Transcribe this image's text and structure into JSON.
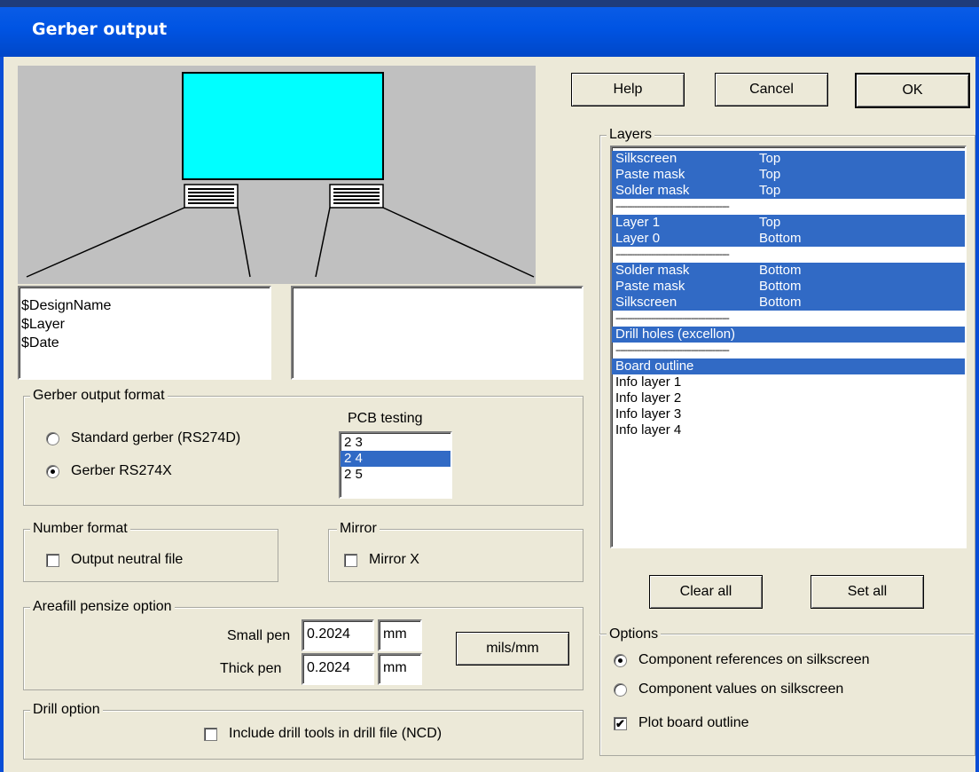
{
  "window": {
    "title": "Gerber output"
  },
  "buttons": {
    "help": "Help",
    "cancel": "Cancel",
    "ok": "OK",
    "clear_all": "Clear all",
    "set_all": "Set all",
    "units": "mils/mm"
  },
  "preview": {
    "text_lines": [
      "$DesignName",
      "$Layer",
      "$Date"
    ],
    "board_color": "#00ffff"
  },
  "gerber_format": {
    "label": "Gerber output format",
    "standard": "Standard gerber (RS274D)",
    "x": "Gerber RS274X",
    "selected": "Gerber RS274X",
    "pcb_testing_label": "PCB testing",
    "pcb_testing_items": [
      "2 3",
      "2 4",
      "2 5"
    ],
    "pcb_testing_selected": "2 4"
  },
  "number_format": {
    "label": "Number format",
    "neutral": "Output neutral file",
    "neutral_checked": false
  },
  "mirror": {
    "label": "Mirror",
    "x": "Mirror X",
    "x_checked": false
  },
  "areafill": {
    "label": "Areafill pensize option",
    "small_label": "Small pen",
    "small_value": "0.2024",
    "small_unit": "mm",
    "thick_label": "Thick pen",
    "thick_value": "0.2024",
    "thick_unit": "mm"
  },
  "drill": {
    "label": "Drill option",
    "include": "Include drill tools in drill file (NCD)",
    "include_checked": false
  },
  "layers": {
    "label": "Layers",
    "separator": "------------------------------------------------",
    "rows": [
      {
        "name": "Silkscreen",
        "side": "Top",
        "selected": true
      },
      {
        "name": "Paste mask",
        "side": "Top",
        "selected": true
      },
      {
        "name": "Solder mask",
        "side": "Top",
        "selected": true
      },
      {
        "sep": true
      },
      {
        "name": "Layer 1",
        "side": "Top",
        "selected": true
      },
      {
        "name": "Layer 0",
        "side": "Bottom",
        "selected": true
      },
      {
        "sep": true
      },
      {
        "name": "Solder mask",
        "side": "Bottom",
        "selected": true
      },
      {
        "name": "Paste mask",
        "side": "Bottom",
        "selected": true
      },
      {
        "name": "Silkscreen",
        "side": "Bottom",
        "selected": true
      },
      {
        "sep": true
      },
      {
        "name": "Drill holes (excellon)",
        "side": "",
        "selected": true
      },
      {
        "sep": true
      },
      {
        "name": "Board outline",
        "side": "",
        "selected": true
      },
      {
        "name": "Info layer 1",
        "side": "",
        "selected": false
      },
      {
        "name": "Info layer 2",
        "side": "",
        "selected": false
      },
      {
        "name": "Info layer 3",
        "side": "",
        "selected": false
      },
      {
        "name": "Info layer 4",
        "side": "",
        "selected": false
      }
    ]
  },
  "options": {
    "label": "Options",
    "refs": "Component references on silkscreen",
    "values": "Component values on silkscreen",
    "selected": "Component references on silkscreen",
    "outline": "Plot board outline",
    "outline_checked": true
  }
}
